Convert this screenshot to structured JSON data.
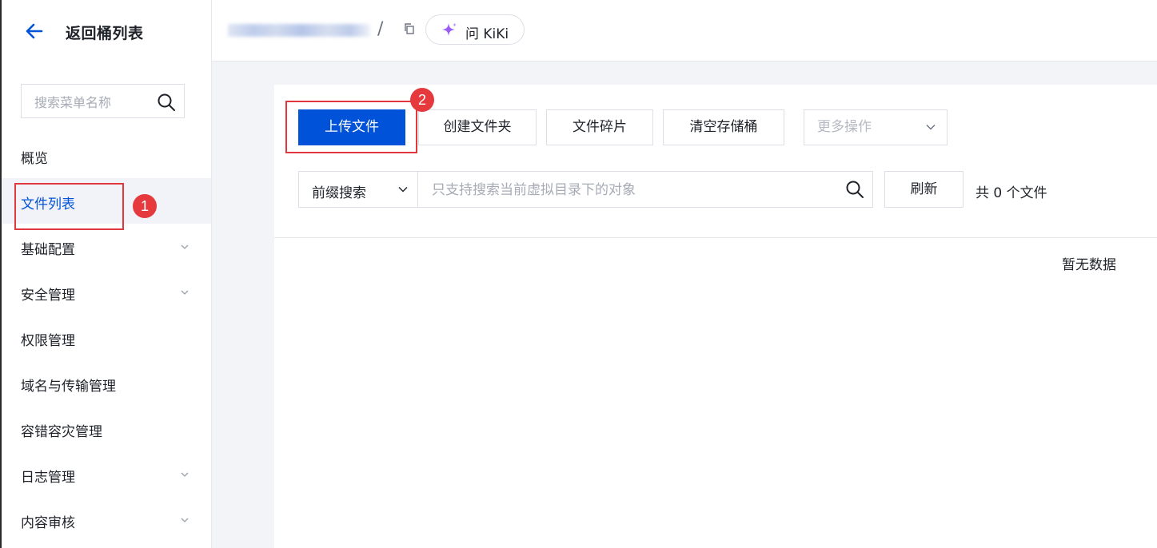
{
  "sidebar": {
    "back_title": "返回桶列表",
    "search_placeholder": "搜索菜单名称",
    "items": [
      {
        "label": "概览"
      },
      {
        "label": "文件列表"
      },
      {
        "label": "基础配置"
      },
      {
        "label": "安全管理"
      },
      {
        "label": "权限管理"
      },
      {
        "label": "域名与传输管理"
      },
      {
        "label": "容错容灾管理"
      },
      {
        "label": "日志管理"
      },
      {
        "label": "内容审核"
      }
    ]
  },
  "header": {
    "breadcrumb_separator": "/",
    "kiki_label": "问 KiKi"
  },
  "toolbar": {
    "upload": "上传文件",
    "create_folder": "创建文件夹",
    "fragments": "文件碎片",
    "empty_bucket": "清空存储桶",
    "more_actions": "更多操作"
  },
  "search": {
    "prefix_select": "前缀搜索",
    "placeholder": "只支持搜索当前虚拟目录下的对象",
    "refresh": "刷新",
    "count": "共 0 个文件"
  },
  "table": {
    "empty_text": "暂无数据"
  },
  "annotations": {
    "badge_1": "1",
    "badge_2": "2"
  },
  "colors": {
    "primary": "#0052d9",
    "annotation_red": "#e0383e",
    "kiki_spark": "#9b5cf6"
  }
}
